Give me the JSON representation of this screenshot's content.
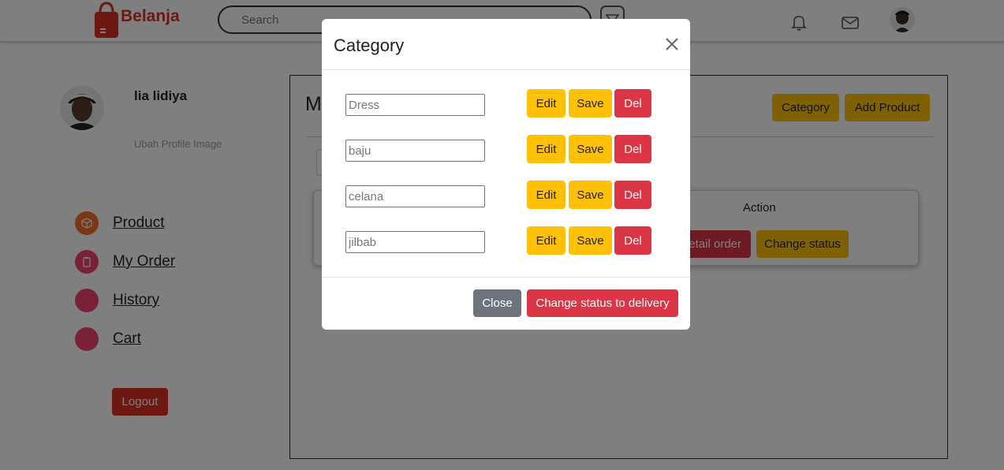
{
  "navbar": {
    "brand": "Belanja",
    "search_placeholder": "Search",
    "icons": [
      "bag-logo-icon",
      "filter-icon",
      "bell-icon",
      "mail-icon"
    ]
  },
  "profile": {
    "name": "lia lidiya",
    "subtitle": "Ubah Profile Image"
  },
  "sidebar": {
    "items": [
      {
        "label": "Product",
        "color": "#f36f2a",
        "icon": "box-icon"
      },
      {
        "label": "My Order",
        "color": "#f3456f",
        "icon": "clipboard-icon"
      },
      {
        "label": "History",
        "color": "#f3456f",
        "icon": "circle-icon"
      },
      {
        "label": "Cart",
        "color": "#f3456f",
        "icon": "circle-icon"
      }
    ],
    "logout_label": "Logout"
  },
  "main": {
    "title_visible": "M",
    "category_button": "Category",
    "add_product_button": "Add Product",
    "table": {
      "action_header": "Action",
      "detail_order_visible": "etail order",
      "change_status_button": "Change status"
    }
  },
  "modal": {
    "title": "Category",
    "categories": [
      {
        "value": "Dress"
      },
      {
        "value": "baju"
      },
      {
        "value": "celana"
      },
      {
        "value": "jilbab"
      }
    ],
    "row_buttons": {
      "edit": "Edit",
      "save": "Save",
      "del": "Del"
    },
    "footer": {
      "close": "Close",
      "change_status": "Change status to delivery"
    }
  },
  "colors": {
    "brand": "#db3022",
    "warning": "#ffc107",
    "danger": "#dc3545",
    "secondary": "#6c757d"
  }
}
